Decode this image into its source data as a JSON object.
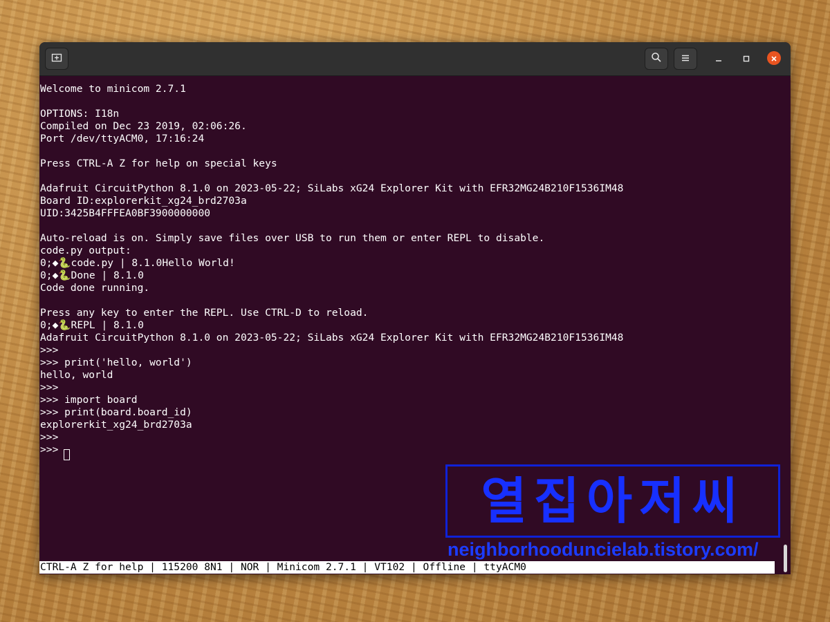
{
  "window": {
    "buttons": {
      "new_tab": "new-tab-icon",
      "search": "search-icon",
      "menu": "hamburger-menu-icon",
      "minimize": "minimize-icon",
      "maximize": "maximize-icon",
      "close": "close-icon"
    },
    "accent_close": "#e95420",
    "terminal_bg": "#300a24"
  },
  "terminal": {
    "lines": [
      {
        "text": "Welcome to minicom 2.7.1",
        "row": 1
      },
      {
        "text": "OPTIONS: I18n",
        "row": 3
      },
      {
        "text": "Compiled on Dec 23 2019, 02:06:26.",
        "row": 4
      },
      {
        "text": "Port /dev/ttyACM0, 17:16:24",
        "row": 5
      },
      {
        "text": "Press CTRL-A Z for help on special keys",
        "row": 7
      },
      {
        "text": "Adafruit CircuitPython 8.1.0 on 2023-05-22; SiLabs xG24 Explorer Kit with EFR32MG24B210F1536IM48",
        "row": 9
      },
      {
        "text": "Board ID:explorerkit_xg24_brd2703a",
        "row": 10
      },
      {
        "text": "UID:3425B4FFFEA0BF3900000000",
        "row": 11
      },
      {
        "text": "Auto-reload is on. Simply save files over USB to run them or enter REPL to disable.",
        "row": 13
      },
      {
        "text": "code.py output:",
        "row": 14
      },
      {
        "prefix": "0;◆",
        "snake": "🐍",
        "text": "code.py | 8.1.0Hello World!",
        "row": 15
      },
      {
        "prefix": "0;◆",
        "snake": "🐍",
        "text": "Done | 8.1.0",
        "row": 16
      },
      {
        "text": "Code done running.",
        "row": 17
      },
      {
        "text": "Press any key to enter the REPL. Use CTRL-D to reload.",
        "row": 19
      },
      {
        "prefix": "0;◆",
        "snake": "🐍",
        "text": "REPL | 8.1.0",
        "row": 20
      },
      {
        "text": "Adafruit CircuitPython 8.1.0 on 2023-05-22; SiLabs xG24 Explorer Kit with EFR32MG24B210F1536IM48",
        "row": 21
      },
      {
        "text": ">>>",
        "row": 22
      },
      {
        "text": ">>> print('hello, world')",
        "row": 23
      },
      {
        "text": "hello, world",
        "row": 24
      },
      {
        "text": ">>>",
        "row": 25
      },
      {
        "text": ">>> import board",
        "row": 26
      },
      {
        "text": ">>> print(board.board_id)",
        "row": 27
      },
      {
        "text": "explorerkit_xg24_brd2703a",
        "row": 28
      },
      {
        "text": ">>>",
        "row": 29
      },
      {
        "text": ">>> ",
        "row": 30
      }
    ]
  },
  "watermark": {
    "korean": "열집아저씨",
    "url": "neighborhooduncielab.tistory.com/",
    "color": "#1730ff"
  },
  "statusbar": {
    "text": "CTRL-A Z for help | 115200 8N1 | NOR | Minicom 2.7.1 | VT102 | Offline | ttyACM0"
  }
}
